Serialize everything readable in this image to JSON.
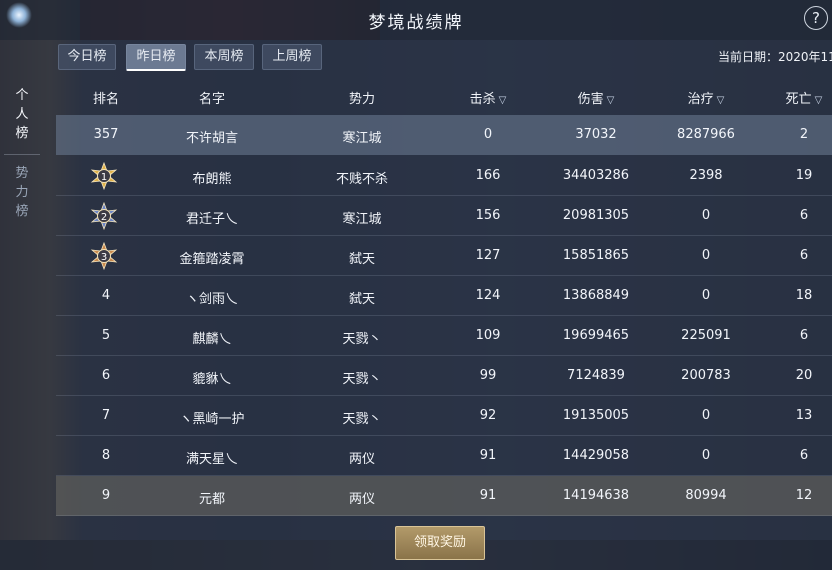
{
  "window": {
    "title": "梦境战绩牌",
    "help_glyph": "?"
  },
  "tabs": [
    {
      "label": "今日榜",
      "active": false
    },
    {
      "label": "昨日榜",
      "active": true
    },
    {
      "label": "本周榜",
      "active": false
    },
    {
      "label": "上周榜",
      "active": false
    }
  ],
  "date_label": "当前日期：2020年11",
  "side_tabs": [
    {
      "label": "个人榜",
      "active": true
    },
    {
      "label": "势力榜",
      "active": false
    }
  ],
  "columns": {
    "rank": "排名",
    "name": "名字",
    "faction": "势力",
    "kills": "击杀",
    "damage": "伤害",
    "healing": "治疗",
    "deaths": "死亡"
  },
  "my_row": {
    "rank": "357",
    "name": "不许胡言",
    "faction": "寒江城",
    "kills": "0",
    "damage": "37032",
    "healing": "8287966",
    "deaths": "2"
  },
  "rows": [
    {
      "rank": "1",
      "medal": "gold",
      "name": "布朗熊",
      "faction": "不贱不杀",
      "kills": "166",
      "damage": "34403286",
      "healing": "2398",
      "deaths": "19"
    },
    {
      "rank": "2",
      "medal": "silver",
      "name": "君迁子乀",
      "faction": "寒江城",
      "kills": "156",
      "damage": "20981305",
      "healing": "0",
      "deaths": "6"
    },
    {
      "rank": "3",
      "medal": "bronze",
      "name": "金箍踏凌霄",
      "faction": "弑天",
      "kills": "127",
      "damage": "15851865",
      "healing": "0",
      "deaths": "6"
    },
    {
      "rank": "4",
      "name": "ヽ剑雨乀",
      "faction": "弑天",
      "kills": "124",
      "damage": "13868849",
      "healing": "0",
      "deaths": "18"
    },
    {
      "rank": "5",
      "name": "麒麟乀",
      "faction": "天戮丶",
      "kills": "109",
      "damage": "19699465",
      "healing": "225091",
      "deaths": "6"
    },
    {
      "rank": "6",
      "name": "貔貅乀",
      "faction": "天戮丶",
      "kills": "99",
      "damage": "7124839",
      "healing": "200783",
      "deaths": "20"
    },
    {
      "rank": "7",
      "name": "ヽ黑崎一护",
      "faction": "天戮丶",
      "kills": "92",
      "damage": "19135005",
      "healing": "0",
      "deaths": "13"
    },
    {
      "rank": "8",
      "name": "满天星乀",
      "faction": "两仪",
      "kills": "91",
      "damage": "14429058",
      "healing": "0",
      "deaths": "6"
    },
    {
      "rank": "9",
      "name": "元都",
      "faction": "两仪",
      "kills": "91",
      "damage": "14194638",
      "healing": "80994",
      "deaths": "12"
    }
  ],
  "reward_button": "领取奖励",
  "colors": {
    "gold": "#e0b24a",
    "silver": "#6d86c4",
    "bronze": "#c98a4e"
  }
}
